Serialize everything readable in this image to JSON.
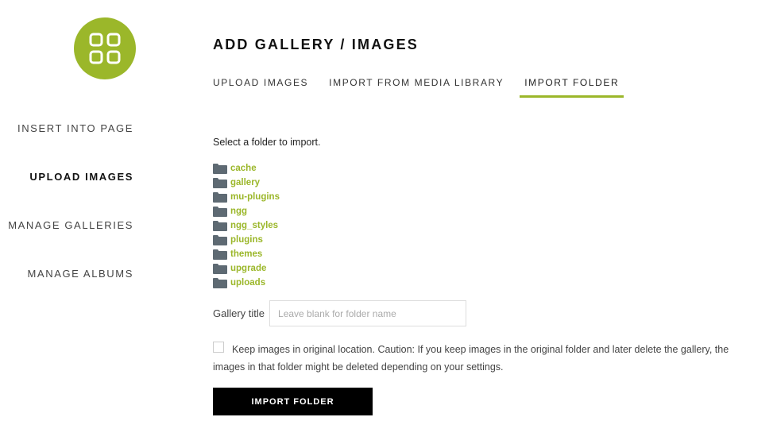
{
  "colors": {
    "accent": "#9bb72a",
    "folder_icon": "#5e6a73",
    "button_bg": "#000000"
  },
  "logo": {
    "icon": "four-squares-grid-icon"
  },
  "sidebar": {
    "items": [
      {
        "label": "INSERT INTO PAGE",
        "active": false
      },
      {
        "label": "UPLOAD IMAGES",
        "active": true
      },
      {
        "label": "MANAGE GALLERIES",
        "active": false
      },
      {
        "label": "MANAGE ALBUMS",
        "active": false
      }
    ]
  },
  "header": {
    "title": "ADD GALLERY / IMAGES"
  },
  "tabs": [
    {
      "label": "UPLOAD IMAGES",
      "active": false
    },
    {
      "label": "IMPORT FROM MEDIA LIBRARY",
      "active": false
    },
    {
      "label": "IMPORT FOLDER",
      "active": true
    }
  ],
  "main": {
    "instruction": "Select a folder to import.",
    "folders": [
      "cache",
      "gallery",
      "mu-plugins",
      "ngg",
      "ngg_styles",
      "plugins",
      "themes",
      "upgrade",
      "uploads"
    ],
    "folder_icon": "folder-icon",
    "gallery_title": {
      "label": "Gallery title",
      "value": "",
      "placeholder": "Leave blank for folder name"
    },
    "keep_original": {
      "checked": false,
      "text": "Keep images in original location. Caution: If you keep images in the original folder and later delete the gallery, the images in that folder might be deleted depending on your settings."
    },
    "import_button": "IMPORT FOLDER"
  }
}
